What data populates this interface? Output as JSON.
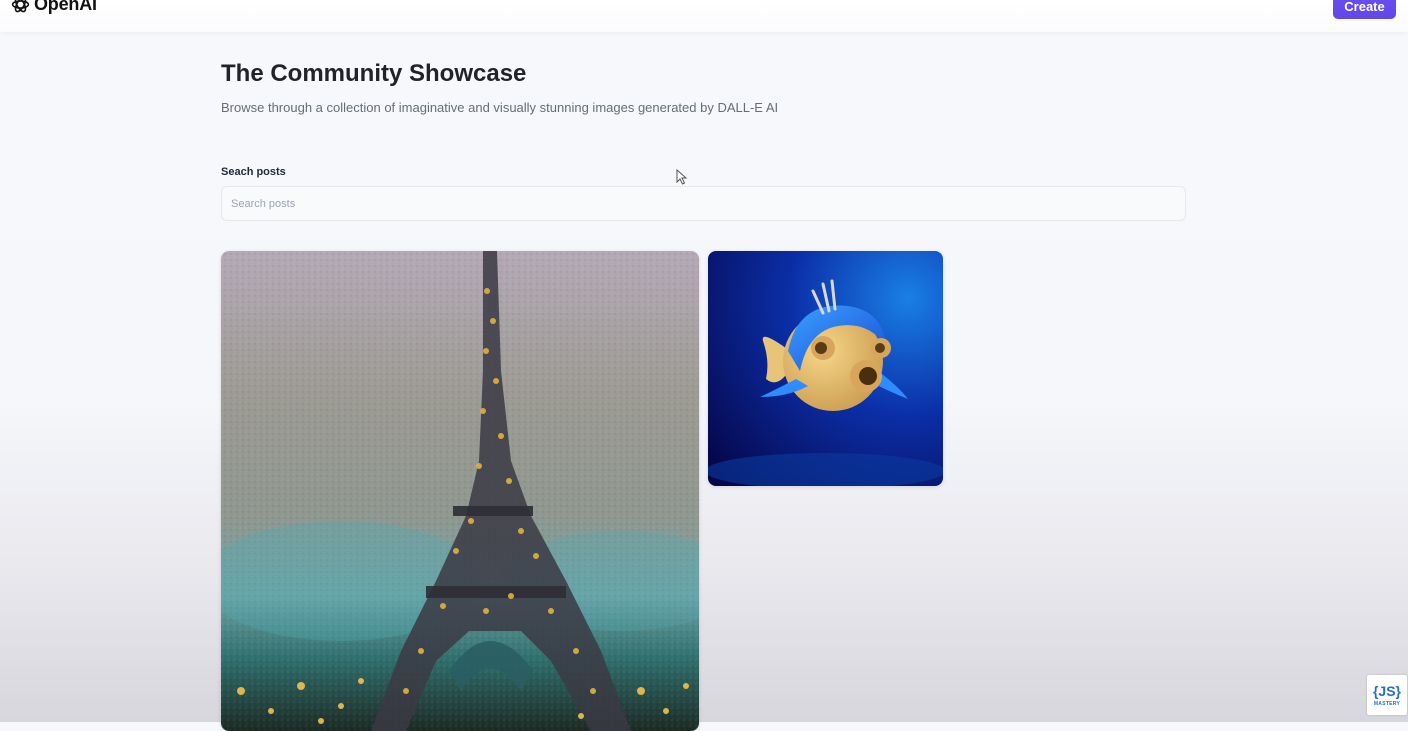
{
  "header": {
    "logo_text": "OpenAI",
    "create_label": "Create",
    "accent_color": "#6346e6"
  },
  "main": {
    "title": "The Community Showcase",
    "subtitle": "Browse through a collection of imaginative and visually stunning images generated by DALL-E AI",
    "search": {
      "label": "Seach posts",
      "placeholder": "Search posts",
      "value": ""
    }
  },
  "cards": [
    {
      "image": "eiffel-tower-painting"
    },
    {
      "image": "blue-fish-3d-render"
    }
  ],
  "watermark": {
    "main": "{JS}",
    "sub": "MASTERY"
  }
}
